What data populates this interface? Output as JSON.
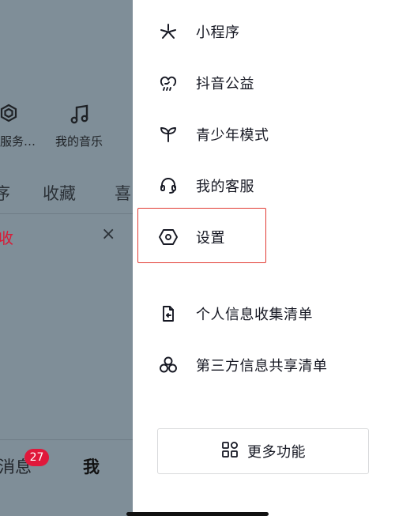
{
  "background_page": {
    "service_label": "服务…",
    "music_label": "我的音乐",
    "tabs": [
      "序",
      "收藏",
      "喜"
    ],
    "notice_text": "收",
    "close_glyph": "×",
    "bottom_nav": {
      "messages_label": "消息",
      "messages_badge": "27",
      "me_label": "我"
    }
  },
  "drawer": {
    "menu_items": [
      {
        "label": "小程序",
        "icon": "mini-program-icon"
      },
      {
        "label": "抖音公益",
        "icon": "charity-icon"
      },
      {
        "label": "青少年模式",
        "icon": "sprout-icon"
      },
      {
        "label": "我的客服",
        "icon": "headset-icon"
      },
      {
        "label": "设置",
        "icon": "settings-hexagon-icon"
      },
      {
        "label": "个人信息收集清单",
        "icon": "document-arrow-icon"
      },
      {
        "label": "第三方信息共享清单",
        "icon": "share-circles-icon"
      }
    ],
    "more_button": {
      "label": "更多功能",
      "icon": "grid-apps-icon"
    }
  },
  "colors": {
    "overlay": "#7f8e98",
    "badge": "#e0183b",
    "highlight_border": "#e23b33",
    "text": "#161823"
  }
}
